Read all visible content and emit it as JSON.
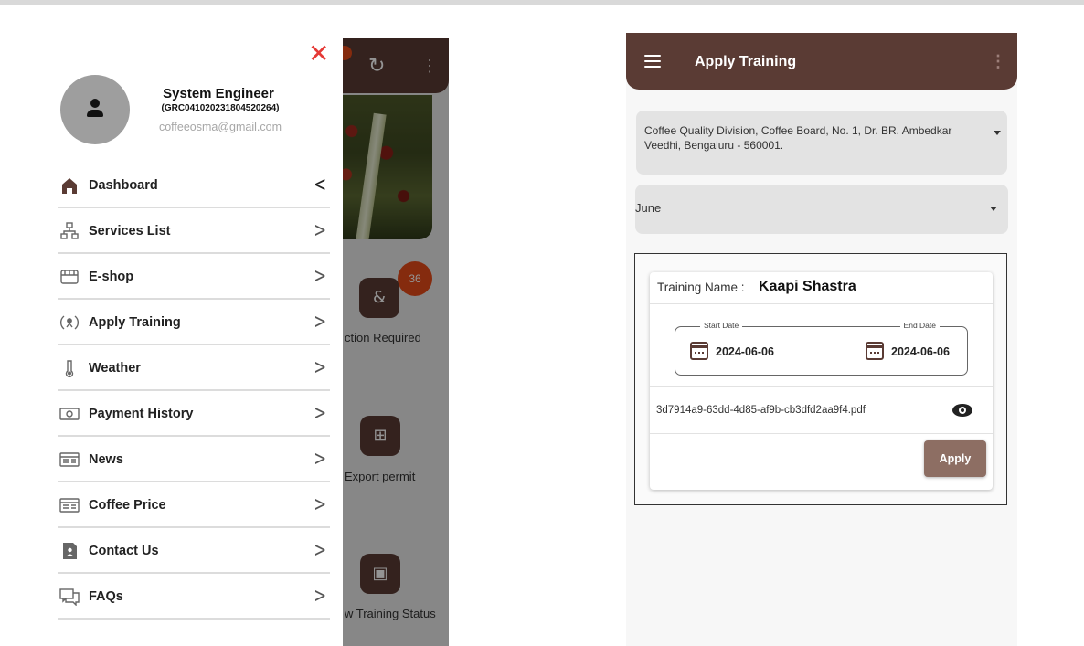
{
  "colors": {
    "brand": "#5a3b34",
    "accent_button": "#8d6e63",
    "close": "#e53935",
    "badge": "#e64a19"
  },
  "left_phone": {
    "background": {
      "refresh_icon": "refresh-icon",
      "badge_count": "36",
      "tiles": [
        {
          "label": "ction Required",
          "icon": "action-required-icon",
          "glyph": "&"
        },
        {
          "label": "Export permit",
          "icon": "grid-icon",
          "glyph": "⊞"
        },
        {
          "label": "w Training Status",
          "icon": "training-status-icon",
          "glyph": "▣"
        }
      ]
    },
    "drawer": {
      "close_glyph": "✕",
      "user": {
        "name": "System  Engineer",
        "id": "(GRC041020231804520264)",
        "email": "coffeeosma@gmail.com"
      },
      "menu": [
        {
          "label": "Dashboard",
          "icon": "home-icon",
          "active": true
        },
        {
          "label": "Services List",
          "icon": "sitemap-icon"
        },
        {
          "label": "E-shop",
          "icon": "shop-icon"
        },
        {
          "label": "Apply Training",
          "icon": "training-icon"
        },
        {
          "label": "Weather",
          "icon": "thermometer-icon"
        },
        {
          "label": "Payment History",
          "icon": "payment-icon"
        },
        {
          "label": "News",
          "icon": "news-icon"
        },
        {
          "label": "Coffee Price",
          "icon": "price-icon"
        },
        {
          "label": "Contact Us",
          "icon": "contact-icon"
        },
        {
          "label": "FAQs",
          "icon": "faq-icon"
        }
      ]
    }
  },
  "right_phone": {
    "appbar": {
      "title": "Apply Training",
      "menu_icon": "hamburger-icon",
      "more_icon": "kebab-icon",
      "more_glyph": "⋮"
    },
    "address_select": {
      "value": "Coffee Quality Division, Coffee Board, No. 1, Dr. BR. Ambedkar Veedhi, Bengaluru - 560001."
    },
    "month_select": {
      "value": "June"
    },
    "training_card": {
      "name_label": "Training Name :",
      "name_value": "Kaapi Shastra",
      "start_label": "Start Date",
      "start_value": "2024-06-06",
      "end_label": "End Date",
      "end_value": "2024-06-06",
      "file_name": "3d7914a9-63dd-4d85-af9b-cb3dfd2aa9f4.pdf",
      "apply_label": "Apply"
    }
  }
}
